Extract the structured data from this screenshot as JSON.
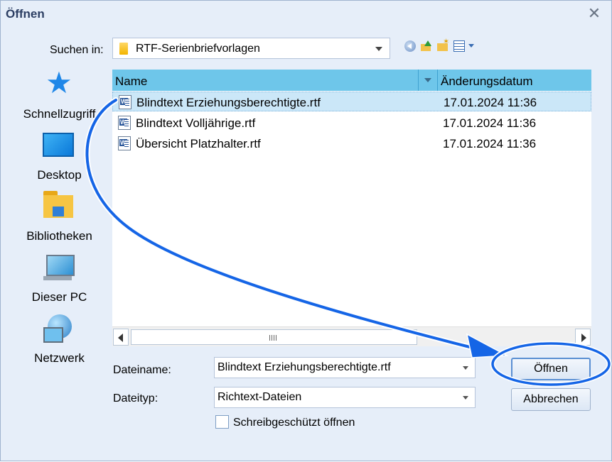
{
  "window": {
    "title": "Öffnen",
    "close_symbol": "✕"
  },
  "toolbar": {
    "lookin_label": "Suchen in:",
    "lookin_value": "RTF-Serienbriefvorlagen",
    "icons": [
      "back-icon",
      "up-folder-icon",
      "new-folder-icon",
      "view-menu-icon"
    ]
  },
  "places": [
    {
      "label": "Schnellzugriff",
      "icon": "quick-access-star-icon"
    },
    {
      "label": "Desktop",
      "icon": "desktop-icon"
    },
    {
      "label": "Bibliotheken",
      "icon": "libraries-icon"
    },
    {
      "label": "Dieser PC",
      "icon": "this-pc-icon"
    },
    {
      "label": "Netzwerk",
      "icon": "network-icon"
    }
  ],
  "filelist": {
    "columns": {
      "name": "Name",
      "date": "Änderungsdatum"
    },
    "files": [
      {
        "name": "Blindtext Erziehungsberechtigte.rtf",
        "date": "17.01.2024 11:36",
        "selected": true
      },
      {
        "name": "Blindtext Volljährige.rtf",
        "date": "17.01.2024 11:36",
        "selected": false
      },
      {
        "name": "Übersicht Platzhalter.rtf",
        "date": "17.01.2024 11:36",
        "selected": false
      }
    ]
  },
  "form": {
    "filename_label": "Dateiname:",
    "filename_value": "Blindtext Erziehungsberechtigte.rtf",
    "filetype_label": "Dateityp:",
    "filetype_value": "Richtext-Dateien",
    "readonly_label": "Schreibgeschützt öffnen",
    "readonly_checked": false
  },
  "buttons": {
    "open": "Öffnen",
    "cancel": "Abbrechen"
  },
  "colors": {
    "header": "#6ec6ea",
    "selection": "#cbe7f8",
    "dialog_bg": "#e6eef9",
    "annotation": "#1565e6"
  }
}
